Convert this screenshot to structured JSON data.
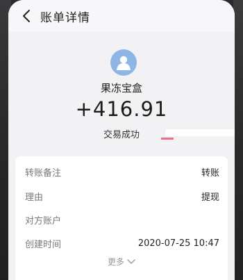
{
  "header": {
    "title": "账单详情"
  },
  "transaction": {
    "counterparty": "果冻宝盒",
    "amount": "+416.91",
    "status": "交易成功"
  },
  "details": {
    "rows": [
      {
        "label": "转账备注",
        "value": "转账"
      },
      {
        "label": "理由",
        "value": "提现"
      },
      {
        "label": "对方账户",
        "value": ""
      },
      {
        "label": "创建时间",
        "value": "2020-07-25 10:47"
      }
    ],
    "more_label": "更多"
  },
  "colors": {
    "avatar_bg": "#8db6e6",
    "page_bg": "#f2f2f4",
    "card_bg": "#ffffff"
  },
  "icons": {
    "back": "chevron-left-icon",
    "avatar": "user-avatar-icon",
    "more": "chevron-down-icon"
  }
}
